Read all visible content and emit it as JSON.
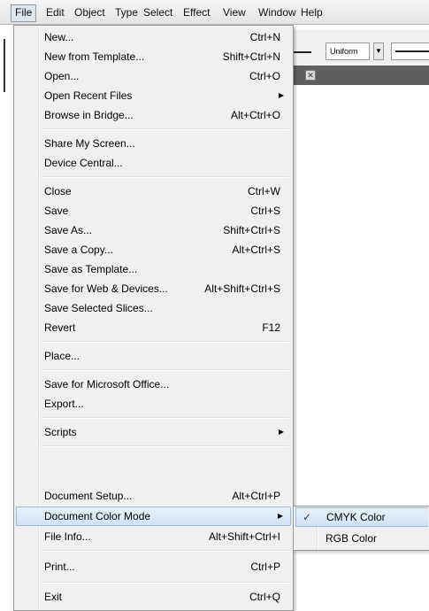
{
  "menubar": {
    "items": [
      {
        "label": "File",
        "active": true
      },
      {
        "label": "Edit"
      },
      {
        "label": "Object"
      },
      {
        "label": "Type"
      },
      {
        "label": "Select"
      },
      {
        "label": "Effect"
      },
      {
        "label": "View"
      },
      {
        "label": "Window"
      },
      {
        "label": "Help"
      }
    ]
  },
  "toolbar": {
    "stroke_profile": "Uniform",
    "dropdown_icon": "chevron-down-icon",
    "close_icon": "close-icon"
  },
  "file_menu": {
    "items": [
      {
        "label": "New...",
        "shortcut": "Ctrl+N"
      },
      {
        "label": "New from Template...",
        "shortcut": "Shift+Ctrl+N"
      },
      {
        "label": "Open...",
        "shortcut": "Ctrl+O"
      },
      {
        "label": "Open Recent Files",
        "submenu": true
      },
      {
        "label": "Browse in Bridge...",
        "shortcut": "Alt+Ctrl+O"
      },
      {
        "label": "Share My Screen..."
      },
      {
        "label": "Device Central..."
      },
      {
        "label": "Close",
        "shortcut": "Ctrl+W"
      },
      {
        "label": "Save",
        "shortcut": "Ctrl+S"
      },
      {
        "label": "Save As...",
        "shortcut": "Shift+Ctrl+S"
      },
      {
        "label": "Save a Copy...",
        "shortcut": "Alt+Ctrl+S"
      },
      {
        "label": "Save as Template..."
      },
      {
        "label": "Save for Web & Devices...",
        "shortcut": "Alt+Shift+Ctrl+S"
      },
      {
        "label": "Save Selected Slices..."
      },
      {
        "label": "Revert",
        "shortcut": "F12"
      },
      {
        "label": "Place..."
      },
      {
        "label": "Save for Microsoft Office..."
      },
      {
        "label": "Export..."
      },
      {
        "label": "Scripts",
        "submenu": true
      },
      {
        "label": "Document Setup...",
        "shortcut": "Alt+Ctrl+P"
      },
      {
        "label": "Document Color Mode",
        "submenu": true,
        "highlighted": true
      },
      {
        "label": "File Info...",
        "shortcut": "Alt+Shift+Ctrl+I"
      },
      {
        "label": "Print...",
        "shortcut": "Ctrl+P"
      },
      {
        "label": "Exit",
        "shortcut": "Ctrl+Q"
      }
    ]
  },
  "color_mode_submenu": {
    "items": [
      {
        "label": "CMYK Color",
        "checked": true,
        "highlighted": true
      },
      {
        "label": "RGB Color",
        "checked": false
      }
    ],
    "check_glyph": "✓"
  },
  "colors": {
    "highlight": "#d1e3f8",
    "menu_bg": "#f0f0f0",
    "check": "#1b3d73"
  }
}
